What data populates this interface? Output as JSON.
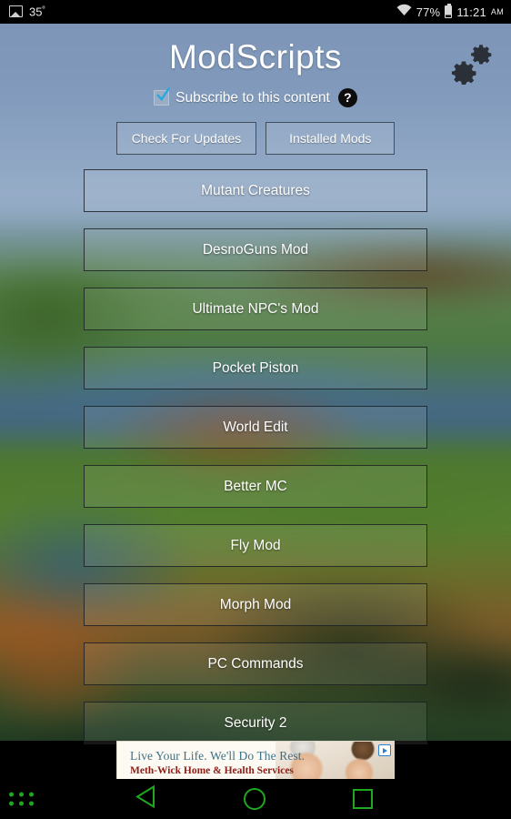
{
  "status_bar": {
    "photo_icon": "photo-icon",
    "temperature": "35",
    "degree": "º",
    "wifi_icon": "wifi-icon",
    "battery_percent": "77%",
    "battery_icon": "battery-icon",
    "time": "11:21",
    "meridiem": "AM"
  },
  "header": {
    "app_title": "ModScripts",
    "settings_icon": "gears-icon",
    "subscribe_label": "Subscribe to this content",
    "subscribe_checked": true,
    "help_icon": "help-icon",
    "help_glyph": "?"
  },
  "toolbar": {
    "check_updates_label": "Check For Updates",
    "installed_mods_label": "Installed Mods"
  },
  "mod_list": [
    {
      "label": "Mutant Creatures"
    },
    {
      "label": "DesnoGuns Mod"
    },
    {
      "label": "Ultimate NPC's Mod"
    },
    {
      "label": "Pocket Piston"
    },
    {
      "label": "World Edit"
    },
    {
      "label": "Better MC"
    },
    {
      "label": "Fly Mod"
    },
    {
      "label": "Morph Mod"
    },
    {
      "label": "PC Commands"
    },
    {
      "label": "Security 2"
    }
  ],
  "ad": {
    "headline": "Live Your Life. We'll Do The Rest.",
    "advertiser": "Meth-Wick Home & Health Services",
    "adchoices_icon": "adchoices-icon",
    "photo": "smiling-women-photo"
  },
  "navbar": {
    "menu_icon": "app-grid-icon",
    "back_icon": "back-triangle-icon",
    "home_icon": "home-circle-icon",
    "recents_icon": "recents-square-icon",
    "accent_color": "#1fa81f"
  },
  "colors": {
    "accent_check": "#29a8e0",
    "title_text": "#ffffff",
    "ad_headline": "#3d7188",
    "ad_advertiser": "#8c2018",
    "status_bar_bg": "#000000"
  }
}
